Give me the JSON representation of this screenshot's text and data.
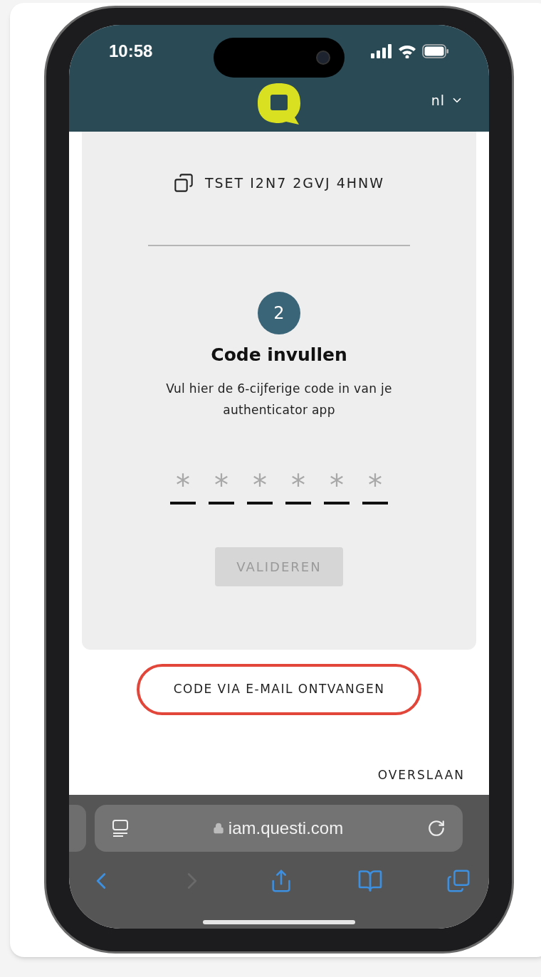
{
  "status_bar": {
    "time": "10:58"
  },
  "header": {
    "language": "nl"
  },
  "secret": {
    "text": "TSET I2N7 2GVJ 4HNW"
  },
  "step": {
    "number": "2",
    "title": "Code invullen",
    "description": "Vul hier de 6-cijferige code in van je authenticator app"
  },
  "code_input": {
    "digits": [
      {
        "placeholder": "*"
      },
      {
        "placeholder": "*"
      },
      {
        "placeholder": "*"
      },
      {
        "placeholder": "*"
      },
      {
        "placeholder": "*"
      },
      {
        "placeholder": "*"
      }
    ]
  },
  "validate_button": {
    "label": "VALIDEREN",
    "disabled": true
  },
  "email_link": {
    "label": "CODE VIA E-MAIL ONTVANGEN",
    "highlighted": true
  },
  "skip_link": {
    "label": "OVERSLAAN"
  },
  "browser": {
    "url": "iam.questi.com",
    "forward_disabled": true
  }
}
